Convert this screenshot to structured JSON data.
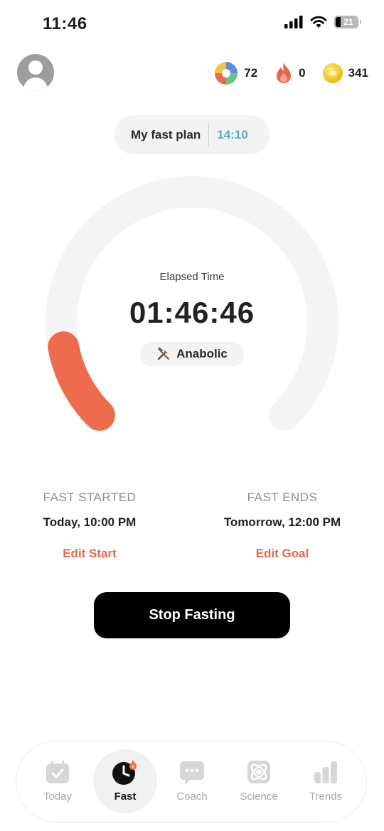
{
  "status_bar": {
    "time": "11:46",
    "battery": "21"
  },
  "header": {
    "stats": [
      {
        "icon": "color-wheel-icon",
        "value": "72"
      },
      {
        "icon": "flame-icon",
        "value": "0"
      },
      {
        "icon": "coin-icon",
        "value": "341"
      }
    ]
  },
  "plan": {
    "label": "My fast plan",
    "value": "14:10"
  },
  "timer": {
    "label": "Elapsed Time",
    "elapsed": "01:46:46",
    "stage_icon": "tools-icon",
    "stage": "Anabolic",
    "progress": 0.127,
    "colors": {
      "track": "#f4f4f4",
      "progress": "#ef6b4e"
    }
  },
  "fast_started": {
    "title": "FAST STARTED",
    "value": "Today, 10:00 PM",
    "action": "Edit Start"
  },
  "fast_ends": {
    "title": "FAST ENDS",
    "value": "Tomorrow, 12:00 PM",
    "action": "Edit Goal"
  },
  "stop_button": "Stop Fasting",
  "tabs": [
    {
      "label": "Today",
      "icon": "calendar-check-icon",
      "active": false
    },
    {
      "label": "Fast",
      "icon": "clock-flame-icon",
      "active": true
    },
    {
      "label": "Coach",
      "icon": "chat-bubble-icon",
      "active": false
    },
    {
      "label": "Science",
      "icon": "atom-icon",
      "active": false
    },
    {
      "label": "Trends",
      "icon": "bar-chart-icon",
      "active": false
    }
  ]
}
